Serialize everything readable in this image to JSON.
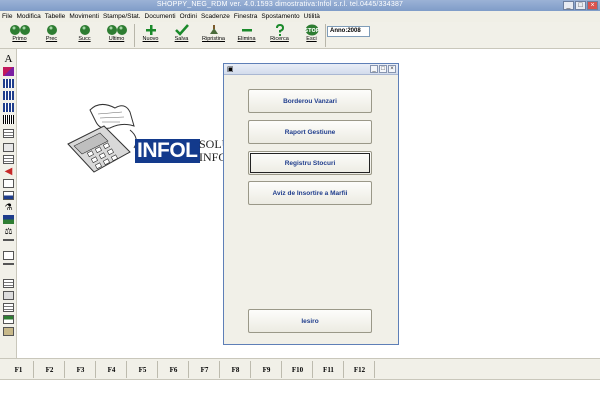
{
  "window": {
    "title": "SHOPPY_NEG_RDM ver. 4.0.1593 dimostrativa:Infol s.r.l. tel.0445/334387"
  },
  "menu": [
    "File",
    "Modifica",
    "Tabelle",
    "Movimenti",
    "Stampe/Stat.",
    "Documenti",
    "Ordini",
    "Scadenze",
    "Finestra",
    "Spostamento",
    "Utilità"
  ],
  "toolbar": {
    "buttons": [
      {
        "label": "Primo",
        "icon": "first-record-icon"
      },
      {
        "label": "Prec",
        "icon": "previous-record-icon"
      },
      {
        "label": "Succ",
        "icon": "next-record-icon"
      },
      {
        "label": "Ultimo",
        "icon": "last-record-icon"
      },
      {
        "label": "Nuovo",
        "icon": "plus-icon"
      },
      {
        "label": "Salva",
        "icon": "checkmark-icon"
      },
      {
        "label": "Ripristina",
        "icon": "restore-icon"
      },
      {
        "label": "Elimina",
        "icon": "minus-icon"
      },
      {
        "label": "Ricerca",
        "icon": "question-icon"
      },
      {
        "label": "Esci",
        "icon": "stop-icon"
      }
    ],
    "year_label": "Anno:2008"
  },
  "logo": {
    "brand": "INFOL",
    "tagline_1": "SOLU",
    "tagline_2": "INFOR"
  },
  "dialog": {
    "buttons": [
      "Borderou Vanzari",
      "Raport Gestiune",
      "Registru Stocuri",
      "Aviz de Insortire a Marfii"
    ],
    "exit_label": "Iesiro"
  },
  "fkeys": [
    "F1",
    "F2",
    "F3",
    "F4",
    "F5",
    "F6",
    "F7",
    "F8",
    "F9",
    "F10",
    "F11",
    "F12"
  ],
  "colors": {
    "accent": "#1f3d8c",
    "titlebar": "#7f9cc8",
    "logo_bg": "#133a8c"
  }
}
